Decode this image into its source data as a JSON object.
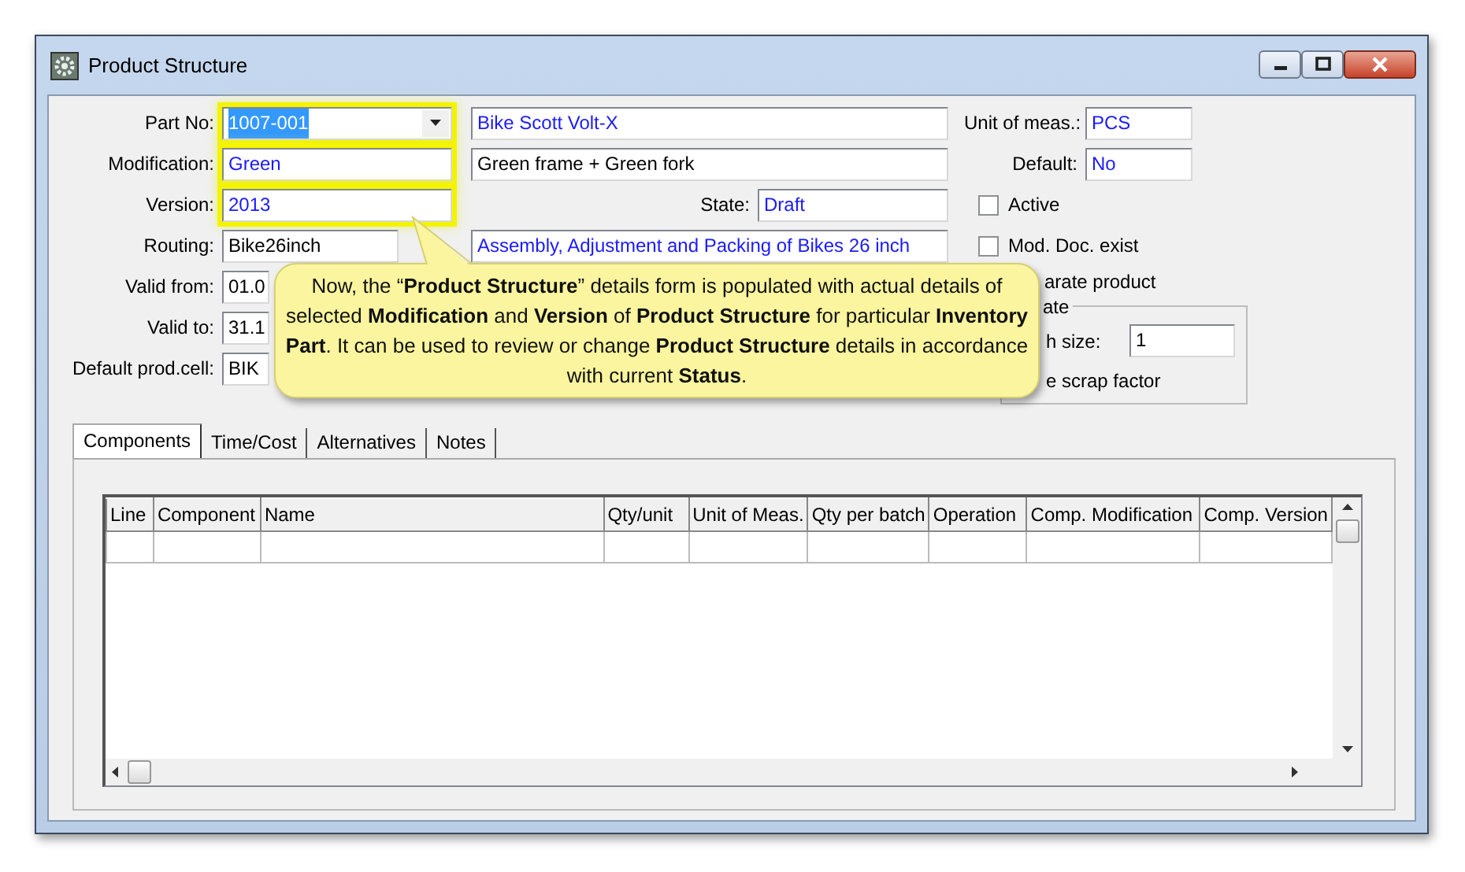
{
  "window": {
    "title": "Product Structure"
  },
  "fields": [
    {
      "label": "Part No:",
      "value": "1007-001",
      "kind": "combo",
      "readonly": true,
      "highlighted": true,
      "text_selected": true
    },
    {
      "label": "Modification:",
      "value": "Green",
      "kind": "text",
      "readonly": true,
      "highlighted": true,
      "text_selected": false
    },
    {
      "label": "Version:",
      "value": "2013",
      "kind": "text",
      "readonly": true,
      "highlighted": true,
      "text_selected": false
    },
    {
      "label": "Routing:",
      "value": "Bike26inch",
      "kind": "text",
      "readonly": false,
      "highlighted": false,
      "text_selected": false
    },
    {
      "label": "Valid from:",
      "value": "01.0",
      "kind": "text",
      "readonly": false,
      "highlighted": false,
      "text_selected": false
    },
    {
      "label": "Valid to:",
      "value": "31.1",
      "kind": "text",
      "readonly": false,
      "highlighted": false,
      "text_selected": false
    },
    {
      "label": "Default prod.cell:",
      "value": "BIK",
      "kind": "text",
      "readonly": false,
      "highlighted": false,
      "text_selected": false
    }
  ],
  "descriptions": [
    {
      "kind": "text",
      "value": "Bike Scott Volt-X",
      "readonly": true
    },
    {
      "kind": "text",
      "value": "Green frame + Green fork",
      "readonly": false
    },
    {
      "kind": "state",
      "label": "State:",
      "value": "Draft",
      "readonly": true
    },
    {
      "kind": "text",
      "value": "Assembly, Adjustment and Packing of Bikes 26 inch",
      "readonly": true
    }
  ],
  "unit_fields": [
    {
      "label": "Unit of meas.:",
      "value": "PCS",
      "readonly": true
    },
    {
      "label": "Default:",
      "value": "No",
      "readonly": true
    }
  ],
  "checkboxes": [
    {
      "label": "Active",
      "checked": false
    },
    {
      "label": "Mod. Doc. exist",
      "checked": false
    }
  ],
  "checkbox_3": {
    "label": "arate product"
  },
  "group_box": {
    "title": "ate",
    "batch_label": "h size:",
    "batch_value": "1",
    "scrap_label": "e scrap factor"
  },
  "tabs": [
    {
      "label": "Components",
      "selected": true
    },
    {
      "label": "Time/Cost",
      "selected": false
    },
    {
      "label": "Alternatives",
      "selected": false
    },
    {
      "label": "Notes",
      "selected": false
    }
  ],
  "table": {
    "columns": [
      "Line",
      "Component",
      "Name",
      "Qty/unit",
      "Unit of Meas.",
      "Qty per batch",
      "Operation",
      "Comp. Modification",
      "Comp. Version"
    ]
  },
  "callout": {
    "text": "Now, the “**Product Structure**” details form is populated with actual details of selected **Modification** and **Version** of **Product Structure** for particular **Inventory Part**. It can be used to review or change **Product Structure** details in accordance with current **Status**."
  }
}
